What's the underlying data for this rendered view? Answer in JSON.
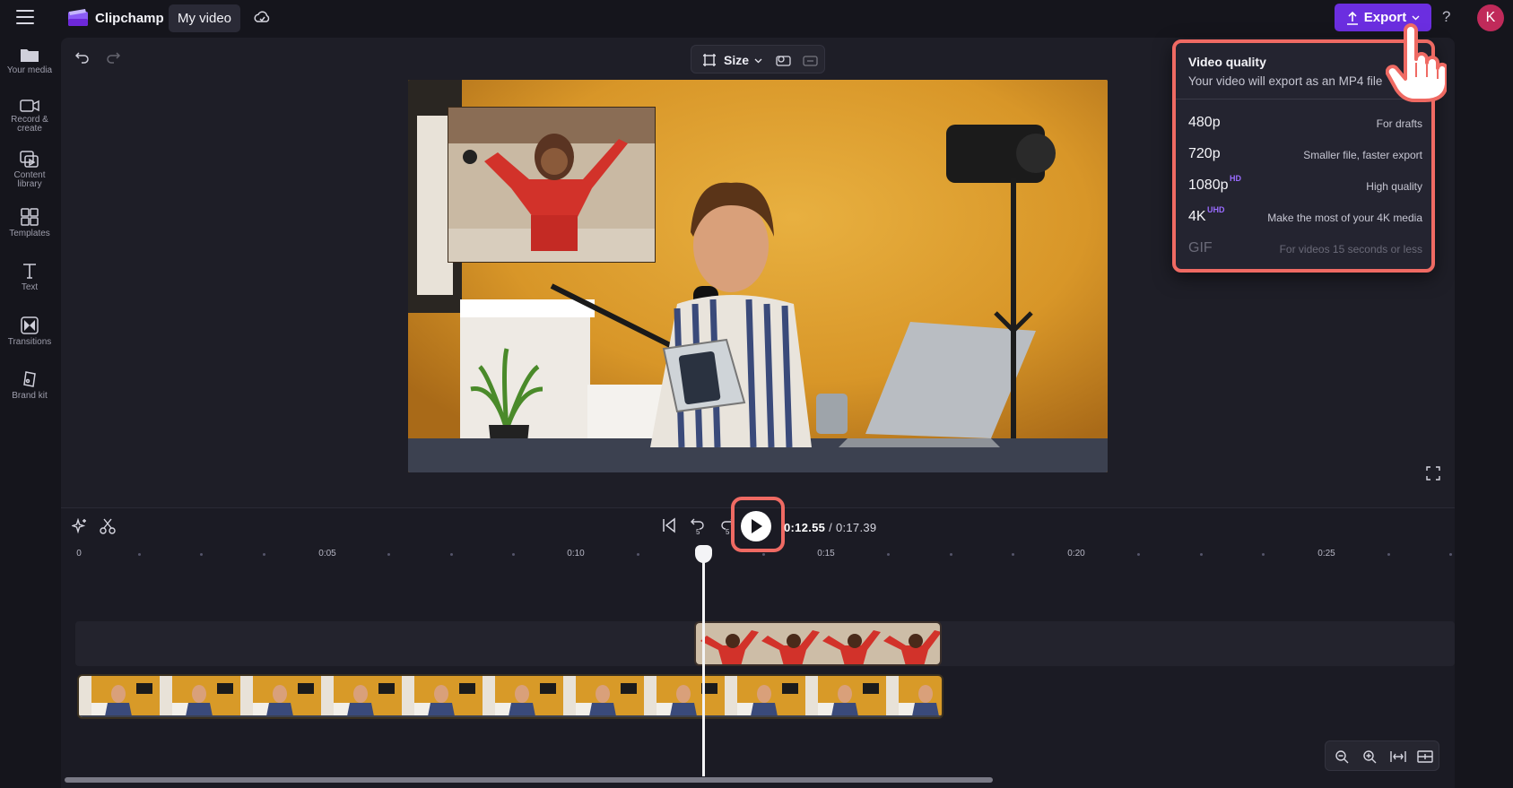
{
  "app": {
    "name": "Clipchamp",
    "project_tab": "My video",
    "export_label": "Export",
    "avatar_initial": "K"
  },
  "sidebar": {
    "items": [
      {
        "label": "Your media",
        "icon": "folder-icon"
      },
      {
        "label": "Record & create",
        "icon": "record-icon"
      },
      {
        "label": "Content library",
        "icon": "content-library-icon"
      },
      {
        "label": "Templates",
        "icon": "templates-icon"
      },
      {
        "label": "Text",
        "icon": "text-icon"
      },
      {
        "label": "Transitions",
        "icon": "transitions-icon"
      },
      {
        "label": "Brand kit",
        "icon": "brand-kit-icon"
      }
    ]
  },
  "toolbar": {
    "size_label": "Size"
  },
  "export_menu": {
    "title": "Video quality",
    "subtitle": "Your video will export as an MP4 file",
    "options": [
      {
        "name": "480p",
        "badge": "",
        "desc": "For drafts",
        "enabled": true
      },
      {
        "name": "720p",
        "badge": "",
        "desc": "Smaller file, faster export",
        "enabled": true
      },
      {
        "name": "1080p",
        "badge": "HD",
        "desc": "High quality",
        "enabled": true
      },
      {
        "name": "4K",
        "badge": "UHD",
        "desc": "Make the most of your 4K media",
        "enabled": true
      },
      {
        "name": "GIF",
        "badge": "",
        "desc": "For videos 15 seconds or less",
        "enabled": false
      }
    ]
  },
  "playback": {
    "current_time": "0:12.55",
    "total_time": "0:17.39",
    "skip_seconds": "5"
  },
  "ruler": {
    "labels": [
      "0",
      "0:05",
      "0:10",
      "0:15",
      "0:20",
      "0:25"
    ]
  },
  "colors": {
    "accent": "#6b2ee0",
    "highlight": "#ef6a63",
    "badge": "#9a6cff"
  }
}
